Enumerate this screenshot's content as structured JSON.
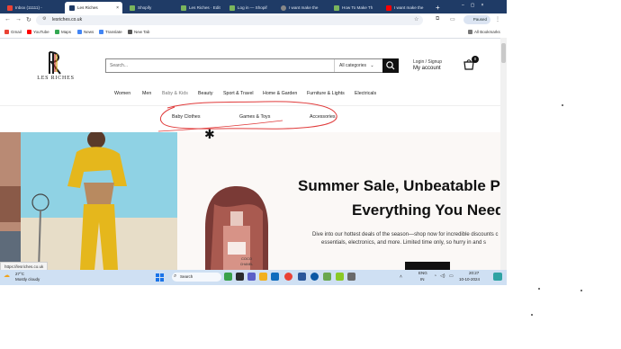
{
  "browser": {
    "tabs": [
      {
        "label": "Inbox (11111) - ",
        "color": "#ea4335"
      },
      {
        "label": "Les Riches",
        "color": "#ffffff"
      },
      {
        "label": "Shopify",
        "color": "#7ab55c"
      },
      {
        "label": "Les Riches · Edit",
        "color": "#7ab55c"
      },
      {
        "label": "Log in — Shopif",
        "color": "#7ab55c"
      },
      {
        "label": "I want make the",
        "color": "#888888"
      },
      {
        "label": "How To Make Th",
        "color": "#7ab55c"
      },
      {
        "label": "I want make the",
        "color": "#ff0000"
      }
    ],
    "new_tab": "+",
    "url": "lesriches.co.uk",
    "profile_label": "Paused",
    "nav_icons": [
      "back-icon",
      "forward-icon",
      "reload-icon"
    ],
    "bookmarks": [
      {
        "label": "Gmail",
        "color": "#ea4335"
      },
      {
        "label": "YouTube",
        "color": "#ff0000"
      },
      {
        "label": "Maps",
        "color": "#34a853"
      },
      {
        "label": "News",
        "color": "#4285f4"
      },
      {
        "label": "Translate",
        "color": "#4285f4"
      },
      {
        "label": "New Tab",
        "color": "#555555"
      }
    ],
    "all_bookmarks": "All Bookmarks"
  },
  "site": {
    "logo_text": "LES RICHES",
    "search_placeholder": "Search...",
    "category_select": "All categories",
    "login_label": "Login / Signup",
    "account_label": "My account",
    "cart_count": "0",
    "nav": [
      "Women",
      "Men",
      "Baby & Kids",
      "Beauty",
      "Sport & Travel",
      "Home & Garden",
      "Furniture & Lights",
      "Electricals"
    ],
    "subnav": [
      "Baby Clothes",
      "Games & Toys",
      "Accessories"
    ],
    "hero": {
      "heading_line1": "Summer Sale, Unbeatable Pr",
      "heading_line2": "Everything You Need",
      "text_line1": "Dive into our hottest deals of the season—shop now for incredible discounts c",
      "text_line2": "essentials, electronics, and more. Limited time only, so hurry in and s",
      "perfume_label": "COCO",
      "perfume_brand": "CHANEL"
    },
    "status_url": "https://lesriches.co.uk"
  },
  "taskbar": {
    "weather_temp": "27°C",
    "weather_desc": "Mostly cloudy",
    "search_label": "Search",
    "lang_top": "ENG",
    "lang_bottom": "IN",
    "time": "20:27",
    "date": "10-10-2024"
  },
  "colors": {
    "tab_strip": "#1f3b66",
    "annotation": "#e03a3a",
    "accent_dark": "#111111"
  }
}
